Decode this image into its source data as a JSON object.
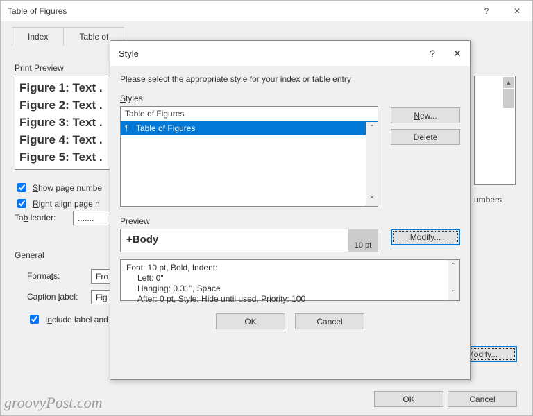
{
  "outer": {
    "title": "Table of Figures",
    "tabs": {
      "index": "Index",
      "tof": "Table of"
    },
    "print_preview_label": "Print Preview",
    "preview_rows": [
      "Figure 1: Text .",
      "Figure 2: Text .",
      "Figure 3: Text .",
      "Figure 4: Text .",
      "Figure 5: Text ."
    ],
    "show_pn": "Show page numbe",
    "right_align": "Right align page n",
    "tab_leader_lbl": "Tab leader:",
    "tab_leader_val": ".......",
    "general_lbl": "General",
    "formats_lbl": "Formats:",
    "formats_val": "Fro",
    "caption_lbl": "Caption label:",
    "caption_val": "Fig",
    "include_lbl": "Include label and",
    "numbers_frag": "umbers",
    "modify_btn": "Modify...",
    "ok": "OK",
    "cancel": "Cancel"
  },
  "style": {
    "title": "Style",
    "instruction": "Please select the appropriate style for your index or table entry",
    "styles_lbl": "Styles:",
    "styles_value": "Table of Figures",
    "list_item": "Table of Figures",
    "new_btn": "New...",
    "delete_btn": "Delete",
    "preview_lbl": "Preview",
    "preview_body": "+Body",
    "preview_pt": "10 pt",
    "modify_btn": "Modify...",
    "desc_l1": "Font: 10 pt, Bold, Indent:",
    "desc_l2": "Left:  0\"",
    "desc_l3": "Hanging:  0.31\", Space",
    "desc_l4": "After:  0 pt, Style: Hide until used, Priority: 100",
    "ok": "OK",
    "cancel": "Cancel"
  },
  "watermark": "groovyPost.com"
}
